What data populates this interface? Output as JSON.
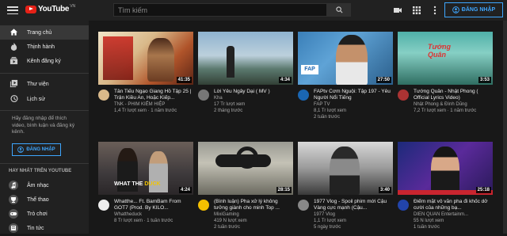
{
  "header": {
    "logo_text": "YouTube",
    "logo_region": "VN",
    "search_placeholder": "Tìm kiếm",
    "signin_label": "ĐĂNG NHẬP"
  },
  "sidebar": {
    "items": [
      {
        "label": "Trang chủ",
        "icon": "home-icon"
      },
      {
        "label": "Thịnh hành",
        "icon": "fire-icon"
      },
      {
        "label": "Kênh đăng ký",
        "icon": "subscriptions-icon"
      },
      {
        "label": "Thư viện",
        "icon": "library-icon"
      },
      {
        "label": "Lịch sử",
        "icon": "history-icon"
      }
    ],
    "note": "Hãy đăng nhập để thích video, bình luận và đăng ký kênh.",
    "signin_label": "ĐĂNG NHẬP",
    "best_heading": "HAY NHẤT TRÊN YOUTUBE",
    "best_items": [
      {
        "label": "Âm nhạc",
        "icon": "music-icon"
      },
      {
        "label": "Thể thao",
        "icon": "sports-icon"
      },
      {
        "label": "Trò chơi",
        "icon": "gaming-icon"
      },
      {
        "label": "Tin tức",
        "icon": "news-icon"
      }
    ]
  },
  "videos": [
    {
      "title": "Tân Tiếu Ngạo Giang Hồ Tập 25 | Trận Kiều An, Hoặc Kiếp...",
      "channel": "TNK - PHIM KIẾM HIỆP",
      "stats": "1,4 Tr lượt xem · 1 năm trước",
      "duration": "41:35"
    },
    {
      "title": "Lời Yêu Ngây Dại ( MV )",
      "channel": "Kha",
      "stats": "17 Tr lượt xem",
      "age": "2 tháng trước",
      "duration": "4:34"
    },
    {
      "title": "FAPtv Cơm Nguội: Tập 197 - Yêu Người Nổi Tiếng",
      "channel": "FAP TV",
      "stats": "8,1 Tr lượt xem",
      "age": "2 tuần trước",
      "duration": "27:50"
    },
    {
      "title": "Tướng Quân - Nhật Phong ( Official Lyrics Video)",
      "channel": "Nhật Phong & Đình Dũng",
      "stats": "7,2 Tr lượt xem · 1 năm trước",
      "duration": "3:53"
    },
    {
      "title": "Whatthe... Ft. BamBam From GOT7 (Prod. By KILO...",
      "channel": "Whattheduck",
      "stats": "8 Tr lượt xem · 1 tuần trước",
      "duration": "4:24"
    },
    {
      "title": "(Bình luận) Pha xử lý không tưởng giành cho minh Top ...",
      "channel": "MixiGaming",
      "stats": "419 N lượt xem",
      "age": "2 tuần trước",
      "duration": "28:15"
    },
    {
      "title": "1977 Vlog - Spoil phim mới Cậu Vàng cực mạnh (Cậu...",
      "channel": "1977 Vlog",
      "stats": "1,1 Tr lượt xem",
      "age": "5 ngày trước",
      "duration": "3:40"
    },
    {
      "title": "Điểm mặt vô văn pha đi khốc dở cười của những bạ...",
      "channel": "DIEN QUAN Entertainm...",
      "stats": "55 N lượt xem",
      "age": "1 tuần trước",
      "duration": "25:18"
    }
  ]
}
